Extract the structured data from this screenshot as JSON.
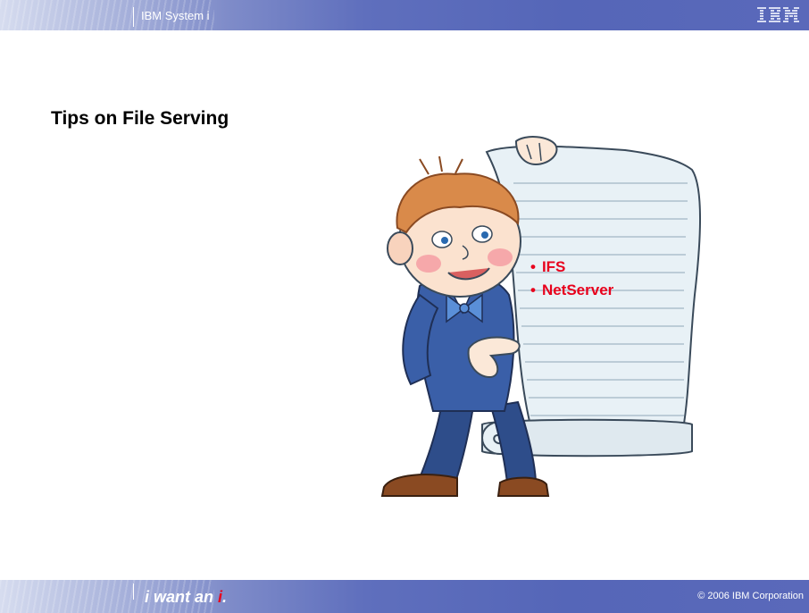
{
  "header": {
    "title": "IBM System i",
    "logo": "IBM"
  },
  "slide": {
    "title": "Tips on File Serving",
    "bullets": [
      "IFS",
      "NetServer"
    ],
    "bullet_marker": "•",
    "illustration": "boy-holding-scroll-clipart"
  },
  "footer": {
    "tagline_main": "i want an ",
    "tagline_accent": "i",
    "tagline_end": ".",
    "copyright": "© 2006 IBM Corporation"
  },
  "colors": {
    "header_blue": "#5566b8",
    "bullet_red": "#e8001c",
    "title_black": "#000000"
  }
}
